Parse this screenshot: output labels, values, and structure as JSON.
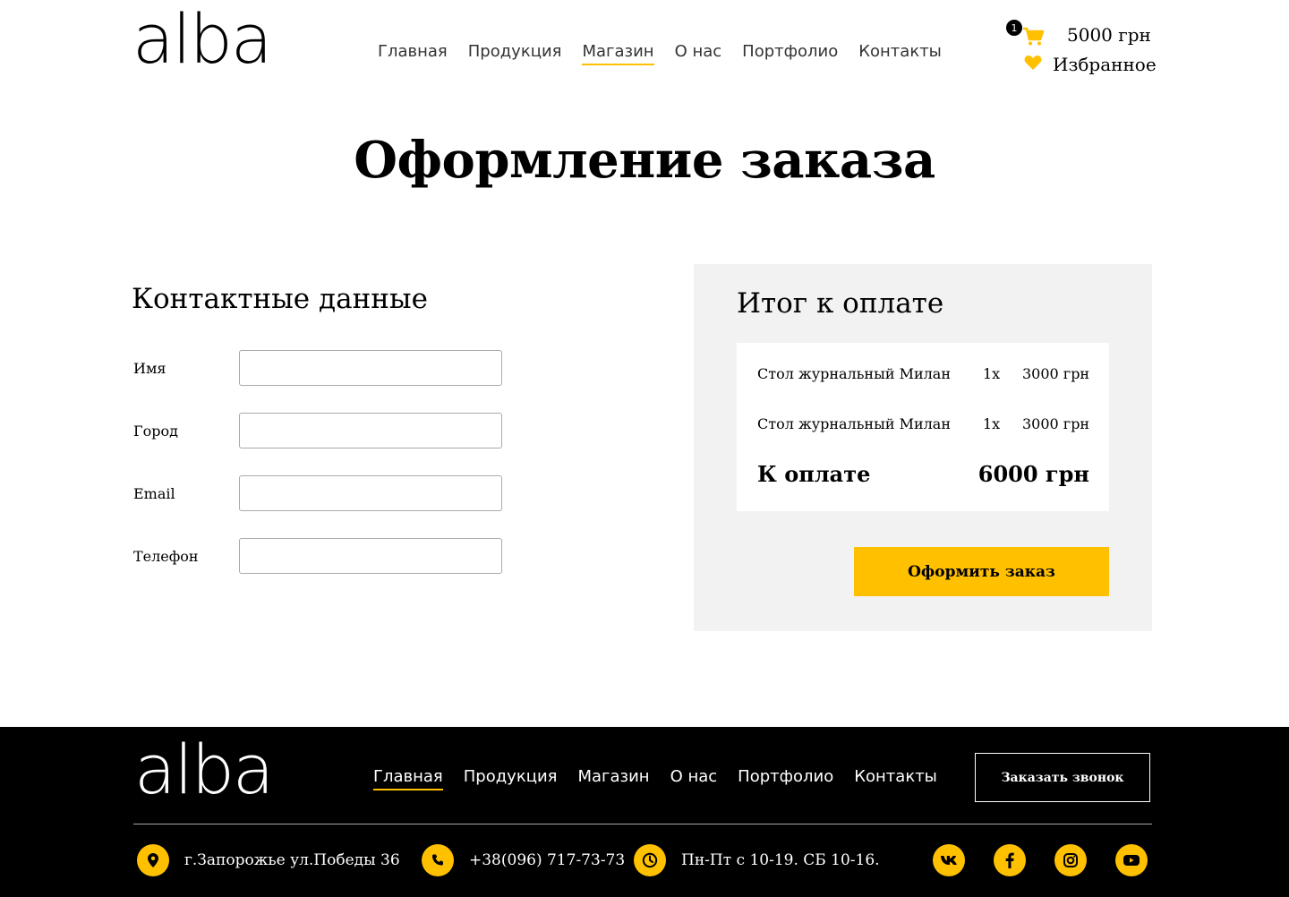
{
  "brand": {
    "logo_text": "alba"
  },
  "header": {
    "nav": [
      {
        "label": "Главная",
        "active": false
      },
      {
        "label": "Продукция",
        "active": false
      },
      {
        "label": "Магазин",
        "active": true
      },
      {
        "label": "О нас",
        "active": false
      },
      {
        "label": "Портфолио",
        "active": false
      },
      {
        "label": "Контакты",
        "active": false
      }
    ],
    "cart": {
      "count": "1",
      "total": "5000 грн",
      "icon": "cart-icon"
    },
    "favorites": {
      "label": "Избранное",
      "icon": "heart-icon"
    }
  },
  "page": {
    "title": "Оформление заказа"
  },
  "contact": {
    "title": "Контактные данные",
    "fields": [
      {
        "label": "Имя",
        "value": "",
        "placeholder": ""
      },
      {
        "label": "Город",
        "value": "",
        "placeholder": ""
      },
      {
        "label": "Email",
        "value": "",
        "placeholder": ""
      },
      {
        "label": "Телефон",
        "value": "",
        "placeholder": ""
      }
    ]
  },
  "summary": {
    "title": "Итог к оплате",
    "items": [
      {
        "name": "Стол журнальный Милан",
        "qty": "1х",
        "price": "3000 грн"
      },
      {
        "name": "Стол журнальный Милан",
        "qty": "1х",
        "price": "3000 грн"
      }
    ],
    "total_label": "К оплате",
    "total_value": "6000 грн",
    "order_button": "Оформить заказ"
  },
  "footer": {
    "nav": [
      {
        "label": "Главная",
        "active": true
      },
      {
        "label": "Продукция",
        "active": false
      },
      {
        "label": "Магазин",
        "active": false
      },
      {
        "label": "О нас",
        "active": false
      },
      {
        "label": "Портфолио",
        "active": false
      },
      {
        "label": "Контакты",
        "active": false
      }
    ],
    "call_button": "Заказать звонок",
    "address": "г.Запорожье ул.Победы 36",
    "phone": "+38(096) 717-73-73",
    "hours": "Пн-Пт с 10-19. СБ 10-16.",
    "social": [
      "vk-icon",
      "facebook-icon",
      "instagram-icon",
      "youtube-icon"
    ]
  },
  "colors": {
    "accent": "#ffc000",
    "summary_bg": "#f2f2f2",
    "footer_bg": "#000000"
  }
}
